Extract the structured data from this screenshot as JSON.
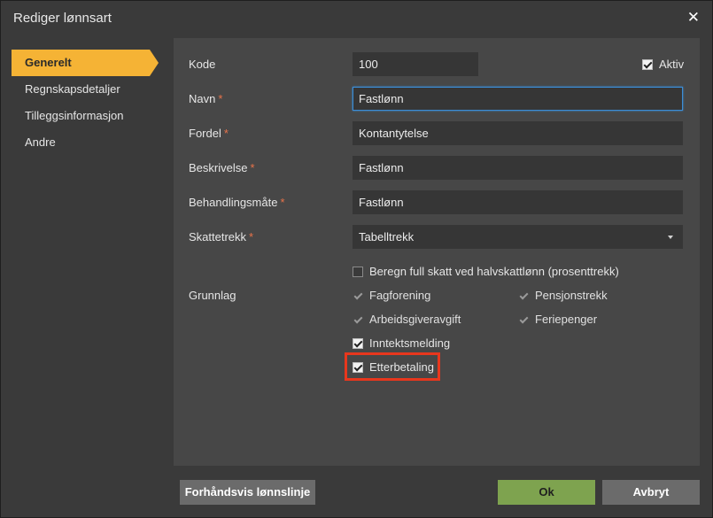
{
  "dialog": {
    "title": "Rediger lønnsart",
    "close_symbol": "✕"
  },
  "sidebar": {
    "items": [
      {
        "label": "Generelt",
        "active": true
      },
      {
        "label": "Regnskapsdetaljer",
        "active": false
      },
      {
        "label": "Tilleggsinformasjon",
        "active": false
      },
      {
        "label": "Andre",
        "active": false
      }
    ]
  },
  "form": {
    "required_marker": "*",
    "kode": {
      "label": "Kode",
      "value": "100"
    },
    "aktiv": {
      "label": "Aktiv",
      "checked": true
    },
    "navn": {
      "label": "Navn",
      "value": "Fastlønn"
    },
    "fordel": {
      "label": "Fordel",
      "value": "Kontantytelse"
    },
    "beskrivelse": {
      "label": "Beskrivelse",
      "value": "Fastlønn"
    },
    "behandlingsmate": {
      "label": "Behandlingsmåte",
      "value": "Fastlønn"
    },
    "skattetrekk": {
      "label": "Skattetrekk",
      "value": "Tabelltrekk"
    },
    "full_skatt": {
      "label": "Beregn full skatt ved halvskattlønn (prosenttrekk)",
      "checked": false
    },
    "grunnlag": {
      "label": "Grunnlag",
      "options": {
        "fagforening": {
          "label": "Fagforening",
          "checked": true
        },
        "pensjonstrekk": {
          "label": "Pensjonstrekk",
          "checked": true
        },
        "arbeidsgiveravgift": {
          "label": "Arbeidsgiveravgift",
          "checked": true
        },
        "feriepenger": {
          "label": "Feriepenger",
          "checked": true
        },
        "inntektsmelding": {
          "label": "Inntektsmelding",
          "checked": true
        },
        "etterbetaling": {
          "label": "Etterbetaling",
          "checked": true
        }
      }
    }
  },
  "footer": {
    "preview_label": "Forhåndsvis lønnslinje",
    "ok_label": "Ok",
    "cancel_label": "Avbryt"
  },
  "colors": {
    "accent": "#f5b335",
    "ok_button": "#7ea34f",
    "focus_border": "#3b8ed8",
    "highlight": "#e8371d",
    "required": "#e8734a"
  }
}
